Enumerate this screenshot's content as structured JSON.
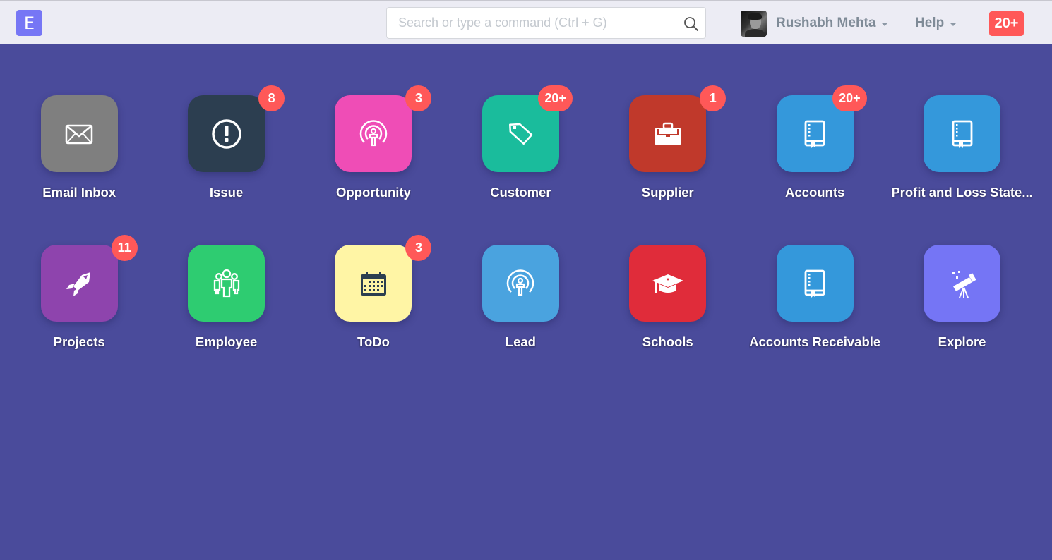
{
  "navbar": {
    "brand_letter": "E",
    "search": {
      "value": "",
      "placeholder": "Search or type a command (Ctrl + G)"
    },
    "user": {
      "name": "Rushabh Mehta"
    },
    "help_label": "Help",
    "notifications_label": "20+"
  },
  "colors": {
    "background": "#4a4b9b",
    "navbar": "#ececf4",
    "brand": "#7676f5",
    "badge": "#ff5858"
  },
  "modules": [
    {
      "label": "Email Inbox",
      "icon": "envelope-icon",
      "color": "#7f7f7f",
      "badge": null
    },
    {
      "label": "Issue",
      "icon": "alert-circle-icon",
      "color": "#2c3e50",
      "badge": "8"
    },
    {
      "label": "Opportunity",
      "icon": "broadcast-icon",
      "color": "#ef4db6",
      "badge": "3"
    },
    {
      "label": "Customer",
      "icon": "tag-icon",
      "color": "#1abc9c",
      "badge": "20+"
    },
    {
      "label": "Supplier",
      "icon": "briefcase-icon",
      "color": "#c0392b",
      "badge": "1"
    },
    {
      "label": "Accounts",
      "icon": "book-icon",
      "color": "#3498db",
      "badge": "20+"
    },
    {
      "label": "Profit and Loss State...",
      "icon": "book-icon",
      "color": "#3498db",
      "badge": null
    },
    {
      "label": "Projects",
      "icon": "rocket-icon",
      "color": "#8e44ad",
      "badge": "11"
    },
    {
      "label": "Employee",
      "icon": "users-icon",
      "color": "#2ecc71",
      "badge": null
    },
    {
      "label": "ToDo",
      "icon": "calendar-icon",
      "color": "#fff5a5",
      "badge": "3"
    },
    {
      "label": "Lead",
      "icon": "broadcast-icon",
      "color": "#4aa3df",
      "badge": null
    },
    {
      "label": "Schools",
      "icon": "graduation-cap-icon",
      "color": "#e02c3a",
      "badge": null
    },
    {
      "label": "Accounts Receivable",
      "icon": "book-icon",
      "color": "#3498db",
      "badge": null
    },
    {
      "label": "Explore",
      "icon": "telescope-icon",
      "color": "#7575f5",
      "badge": null
    }
  ]
}
